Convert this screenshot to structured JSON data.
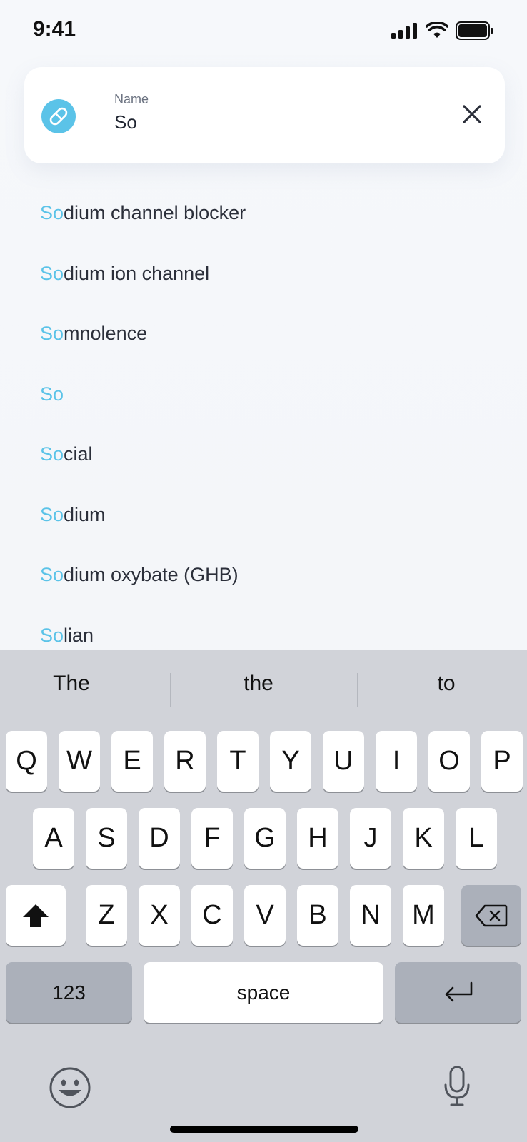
{
  "status_bar": {
    "time": "9:41"
  },
  "search": {
    "label": "Name",
    "value": "So",
    "query": "So"
  },
  "suggestions": [
    {
      "match": "So",
      "rest": "dium channel blocker"
    },
    {
      "match": "So",
      "rest": "dium ion channel"
    },
    {
      "match": "So",
      "rest": "mnolence"
    },
    {
      "match": "So",
      "rest": ""
    },
    {
      "match": "So",
      "rest": "cial"
    },
    {
      "match": "So",
      "rest": "dium"
    },
    {
      "match": "So",
      "rest": "dium oxybate (GHB)"
    },
    {
      "match": "So",
      "rest": "lian"
    }
  ],
  "keyboard": {
    "predictions": [
      "The",
      "the",
      "to"
    ],
    "row1": [
      "Q",
      "W",
      "E",
      "R",
      "T",
      "Y",
      "U",
      "I",
      "O",
      "P"
    ],
    "row2": [
      "A",
      "S",
      "D",
      "F",
      "G",
      "H",
      "J",
      "K",
      "L"
    ],
    "row3": [
      "Z",
      "X",
      "C",
      "V",
      "B",
      "N",
      "M"
    ],
    "numbers_label": "123",
    "space_label": "space",
    "icons": {
      "shift": "shift-arrow-icon",
      "backspace": "backspace-icon",
      "return": "return-icon",
      "emoji": "emoji-icon",
      "dictation": "microphone-icon"
    }
  },
  "colors": {
    "accent": "#5bc3e8",
    "keyboard_bg": "#d1d3d9",
    "key_dark": "#abb0ba"
  }
}
